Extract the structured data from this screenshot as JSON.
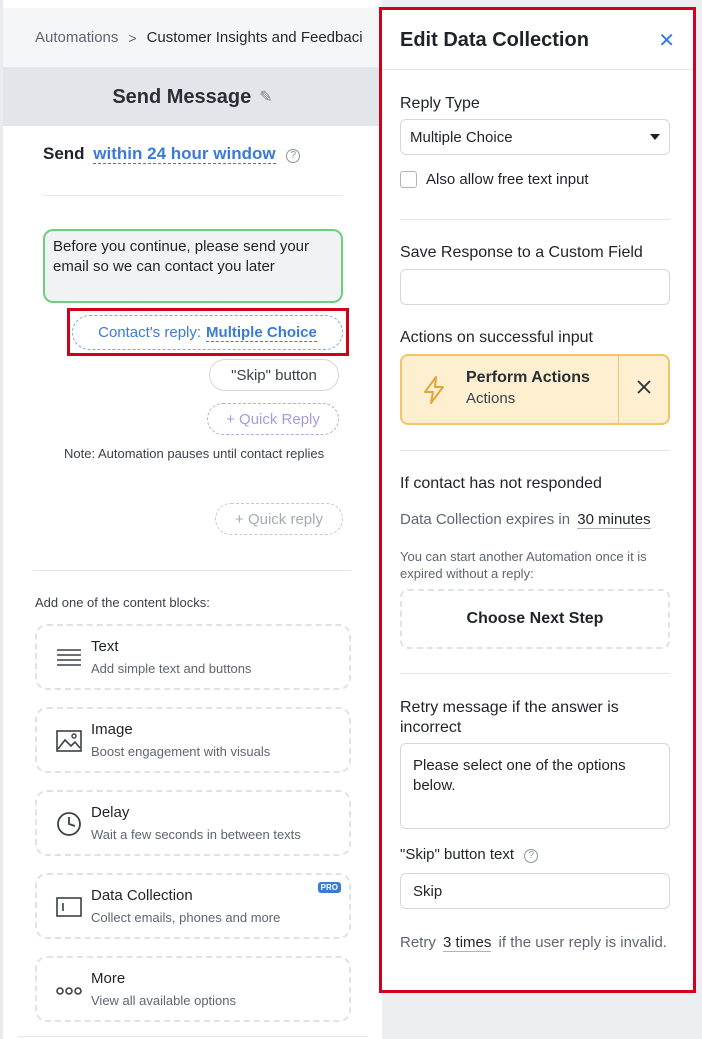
{
  "breadcrumb": {
    "root": "Automations",
    "separator": ">",
    "current": "Customer Insights and Feedbaci"
  },
  "message": {
    "title": "Send Message",
    "send_label": "Send",
    "send_window": "within 24 hour window",
    "bubble_text": "Before you continue, please send your email so we can contact you later",
    "reply_prefix": "Contact's reply:",
    "reply_type": "Multiple Choice",
    "skip_button": "\"Skip\" button",
    "quick_reply": "+ Quick Reply",
    "note": "Note: Automation pauses until contact replies",
    "quick_reply_2": "+ Quick reply"
  },
  "blocks": {
    "heading": "Add one of the content blocks:",
    "items": [
      {
        "title": "Text",
        "subtitle": "Add simple text and buttons",
        "icon": "text-lines-icon"
      },
      {
        "title": "Image",
        "subtitle": "Boost engagement with visuals",
        "icon": "image-icon"
      },
      {
        "title": "Delay",
        "subtitle": "Wait a few seconds in between texts",
        "icon": "clock-icon"
      },
      {
        "title": "Data Collection",
        "subtitle": "Collect emails, phones and more",
        "icon": "data-collection-icon",
        "badge": "PRO"
      },
      {
        "title": "More",
        "subtitle": "View all available options",
        "icon": "more-dots-icon"
      }
    ]
  },
  "panel": {
    "title": "Edit Data Collection",
    "reply_type_label": "Reply Type",
    "reply_type_value": "Multiple Choice",
    "free_text_label": "Also allow free text input",
    "save_response_label": "Save Response to a Custom Field",
    "save_response_value": "",
    "actions_label": "Actions on successful input",
    "actions_title": "Perform Actions",
    "actions_subtitle": "Actions",
    "no_response_label": "If contact has not responded",
    "expires_label": "Data Collection expires in",
    "expires_value": "30 minutes",
    "expired_note": "You can start another Automation once it is expired without a reply:",
    "next_step": "Choose Next Step",
    "retry_label": "Retry message if the answer is incorrect",
    "retry_message": "Please select one of the options below.",
    "skip_text_label": "\"Skip\" button text",
    "skip_text_value": "Skip",
    "retry_prefix": "Retry",
    "retry_times": "3 times",
    "retry_suffix": "if the user reply is invalid."
  },
  "colors": {
    "accent": "#3a7bd5",
    "highlight": "#d0021b",
    "success": "#6ccf7f",
    "actions_bg": "#fdefcf"
  }
}
